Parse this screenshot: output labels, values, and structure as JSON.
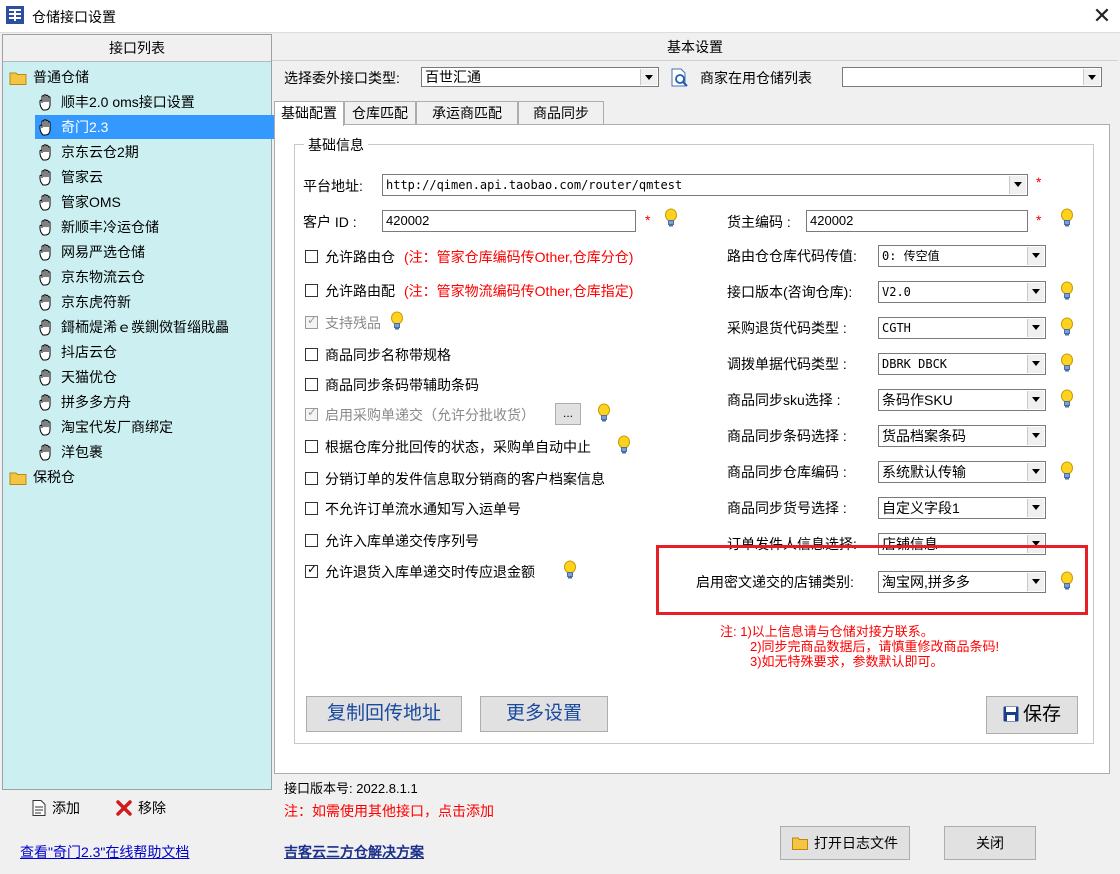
{
  "window": {
    "title": "仓储接口设置",
    "close_glyph": "✕"
  },
  "left_panel": {
    "header": "接口列表",
    "tree": [
      {
        "label": "普通仓储",
        "type": "folder",
        "level": 0
      },
      {
        "label": "顺丰2.0 oms接口设置",
        "type": "hand",
        "level": 1
      },
      {
        "label": "奇门2.3",
        "type": "hand",
        "level": 1,
        "selected": true
      },
      {
        "label": "京东云仓2期",
        "type": "hand",
        "level": 1
      },
      {
        "label": "管家云",
        "type": "hand",
        "level": 1
      },
      {
        "label": "管家OMS",
        "type": "hand",
        "level": 1
      },
      {
        "label": "新顺丰冷运仓储",
        "type": "hand",
        "level": 1
      },
      {
        "label": "网易严选仓储",
        "type": "hand",
        "level": 1
      },
      {
        "label": "京东物流云仓",
        "type": "hand",
        "level": 1
      },
      {
        "label": "京东虎符新",
        "type": "hand",
        "level": 1
      },
      {
        "label": "鎶栭煶浠ｅ彂鍘傚晢缁戝畾",
        "type": "hand",
        "level": 1
      },
      {
        "label": "抖店云仓",
        "type": "hand",
        "level": 1
      },
      {
        "label": "天猫优仓",
        "type": "hand",
        "level": 1
      },
      {
        "label": "拼多多方舟",
        "type": "hand",
        "level": 1
      },
      {
        "label": "淘宝代发厂商绑定",
        "type": "hand",
        "level": 1
      },
      {
        "label": "洋包裹",
        "type": "hand",
        "level": 1
      },
      {
        "label": "保税仓",
        "type": "folder",
        "level": 0
      }
    ],
    "add_label": "添加",
    "remove_label": "移除",
    "help_link": "查看\"奇门2.3\"在线帮助文档"
  },
  "right_panel": {
    "header": "基本设置",
    "interface_type_label": "选择委外接口类型:",
    "interface_type_value": "百世汇通",
    "warehouse_list_label": "商家在用仓储列表",
    "warehouse_list_value": "",
    "tabs": [
      "基础配置",
      "仓库匹配",
      "承运商匹配",
      "商品同步"
    ],
    "group_title": "基础信息",
    "platform_url_label": "平台地址:",
    "platform_url_value": "http://qimen.api.taobao.com/router/qmtest",
    "customer_id_label": "客户 ID :",
    "customer_id_value": "420002",
    "owner_code_label": "货主编码 :",
    "owner_code_value": "420002",
    "required_mark": "*",
    "checkboxes": [
      {
        "label": "允许路由仓",
        "note": "(注：管家仓库编码传Other,仓库分仓)",
        "checked": false,
        "disabled": false
      },
      {
        "label": "允许路由配",
        "note": "(注：管家物流编码传Other,仓库指定)",
        "checked": false,
        "disabled": false
      },
      {
        "label": "支持残品",
        "note": "",
        "checked": true,
        "disabled": true
      },
      {
        "label": "商品同步名称带规格",
        "note": "",
        "checked": false,
        "disabled": false
      },
      {
        "label": "商品同步条码带辅助条码",
        "note": "",
        "checked": false,
        "disabled": false
      },
      {
        "label": "启用采购单递交（允许分批收货）",
        "note": "",
        "checked": true,
        "disabled": true
      },
      {
        "label": "根据仓库分批回传的状态，采购单自动中止",
        "note": "",
        "checked": false,
        "disabled": false
      },
      {
        "label": "分销订单的发件信息取分销商的客户档案信息",
        "note": "",
        "checked": false,
        "disabled": false
      },
      {
        "label": "不允许订单流水通知写入运单号",
        "note": "",
        "checked": false,
        "disabled": false
      },
      {
        "label": "允许入库单递交传序列号",
        "note": "",
        "checked": false,
        "disabled": false
      },
      {
        "label": "允许退货入库单递交时传应退金额",
        "note": "",
        "checked": true,
        "disabled": false
      }
    ],
    "ellipsis_label": "...",
    "settings": [
      {
        "label": "路由仓仓库代码传值:",
        "value": "0: 传空值",
        "mono": true
      },
      {
        "label": "接口版本(咨询仓库):",
        "value": "V2.0",
        "mono": true
      },
      {
        "label": "采购退货代码类型  :",
        "value": "CGTH",
        "mono": true
      },
      {
        "label": "调拨单据代码类型  :",
        "value": "DBRK  DBCK",
        "mono": true
      },
      {
        "label": "商品同步sku选择  :",
        "value": "条码作SKU",
        "mono": false
      },
      {
        "label": "商品同步条码选择  :",
        "value": "货品档案条码",
        "mono": false
      },
      {
        "label": "商品同步仓库编码  :",
        "value": "系统默认传输",
        "mono": false
      },
      {
        "label": "商品同步货号选择  :",
        "value": "自定义字段1",
        "mono": false
      },
      {
        "label": "订单发件人信息选择:",
        "value": "店铺信息",
        "mono": false
      },
      {
        "label": "启用密文递交的店铺类别:",
        "value": "淘宝网,拼多多",
        "mono": false
      }
    ],
    "notes": [
      "注: 1)以上信息请与仓储对接方联系。",
      "2)同步完商品数据后，请慎重修改商品条码!",
      "3)如无特殊要求，参数默认即可。"
    ],
    "copy_url_button": "复制回传地址",
    "more_settings_button": "更多设置",
    "save_button": "保存",
    "version_label": "接口版本号: 2022.8.1.1",
    "add_hint": "注：如需使用其他接口，点击添加",
    "solution_link": "吉客云三方仓解决方案",
    "open_log_button": "打开日志文件",
    "close_button": "关闭"
  },
  "colors": {
    "tree_bg": "#ccf0f2",
    "selected": "#3399ff",
    "highlight_box": "#e81e25",
    "note_red": "#ff0000",
    "button_blue_text": "#1a4aa0"
  }
}
